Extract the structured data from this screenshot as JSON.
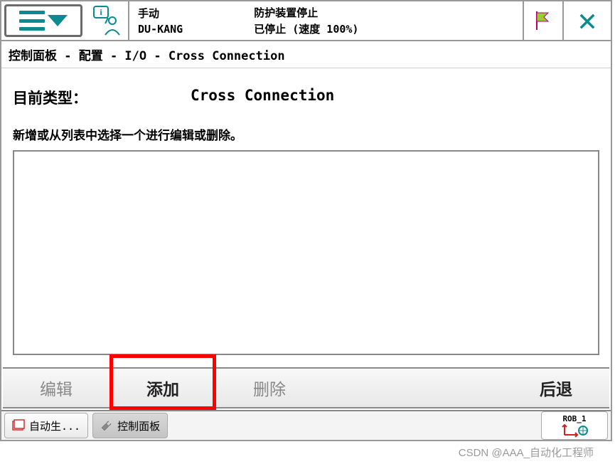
{
  "header": {
    "mode_label": "手动",
    "system_name": "DU-KANG",
    "guard_label": "防护装置停止",
    "status_text": "已停止 (速度 100%)"
  },
  "breadcrumb": "控制面板 - 配置 - I/O - Cross Connection",
  "main": {
    "type_label": "目前类型：",
    "type_value": "Cross Connection",
    "hint": "新增或从列表中选择一个进行编辑或删除。"
  },
  "buttons": {
    "edit": "编辑",
    "add": "添加",
    "delete": "删除",
    "back": "后退"
  },
  "taskbar": {
    "task1": "自动生...",
    "task2": "控制面板",
    "rob_label": "ROB_1"
  },
  "watermark": "CSDN @AAA_自动化工程师"
}
